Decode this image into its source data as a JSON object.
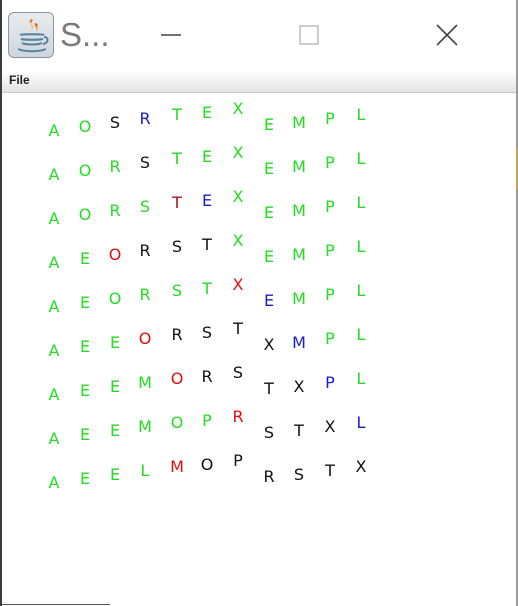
{
  "window": {
    "title": "S...",
    "icon": "java-coffee-cup-icon",
    "controls": [
      "minimize-icon",
      "maximize-icon",
      "close-icon"
    ]
  },
  "menu": {
    "file_label": "File"
  },
  "colors": {
    "green": "#22dd22",
    "black": "#111111",
    "blue": "#1a1acc",
    "red": "#dd1111",
    "darkred": "#aa1122"
  },
  "grid": {
    "rows": [
      [
        [
          "A",
          "green"
        ],
        [
          "O",
          "green"
        ],
        [
          "S",
          "black"
        ],
        [
          "R",
          "blue"
        ],
        [
          "T",
          "green"
        ],
        [
          "E",
          "green"
        ],
        [
          "X",
          "green"
        ],
        [
          "E",
          "green"
        ],
        [
          "M",
          "green"
        ],
        [
          "P",
          "green"
        ],
        [
          "L",
          "green"
        ]
      ],
      [
        [
          "A",
          "green"
        ],
        [
          "O",
          "green"
        ],
        [
          "R",
          "green"
        ],
        [
          "S",
          "black"
        ],
        [
          "T",
          "green"
        ],
        [
          "E",
          "green"
        ],
        [
          "X",
          "green"
        ],
        [
          "E",
          "green"
        ],
        [
          "M",
          "green"
        ],
        [
          "P",
          "green"
        ],
        [
          "L",
          "green"
        ]
      ],
      [
        [
          "A",
          "green"
        ],
        [
          "O",
          "green"
        ],
        [
          "R",
          "green"
        ],
        [
          "S",
          "green"
        ],
        [
          "T",
          "darkred"
        ],
        [
          "E",
          "blue"
        ],
        [
          "X",
          "green"
        ],
        [
          "E",
          "green"
        ],
        [
          "M",
          "green"
        ],
        [
          "P",
          "green"
        ],
        [
          "L",
          "green"
        ]
      ],
      [
        [
          "A",
          "green"
        ],
        [
          "E",
          "green"
        ],
        [
          "O",
          "red"
        ],
        [
          "R",
          "black"
        ],
        [
          "S",
          "black"
        ],
        [
          "T",
          "black"
        ],
        [
          "X",
          "green"
        ],
        [
          "E",
          "green"
        ],
        [
          "M",
          "green"
        ],
        [
          "P",
          "green"
        ],
        [
          "L",
          "green"
        ]
      ],
      [
        [
          "A",
          "green"
        ],
        [
          "E",
          "green"
        ],
        [
          "O",
          "green"
        ],
        [
          "R",
          "green"
        ],
        [
          "S",
          "green"
        ],
        [
          "T",
          "green"
        ],
        [
          "X",
          "red"
        ],
        [
          "E",
          "blue"
        ],
        [
          "M",
          "green"
        ],
        [
          "P",
          "green"
        ],
        [
          "L",
          "green"
        ]
      ],
      [
        [
          "A",
          "green"
        ],
        [
          "E",
          "green"
        ],
        [
          "E",
          "green"
        ],
        [
          "O",
          "red"
        ],
        [
          "R",
          "black"
        ],
        [
          "S",
          "black"
        ],
        [
          "T",
          "black"
        ],
        [
          "X",
          "black"
        ],
        [
          "M",
          "blue"
        ],
        [
          "P",
          "green"
        ],
        [
          "L",
          "green"
        ]
      ],
      [
        [
          "A",
          "green"
        ],
        [
          "E",
          "green"
        ],
        [
          "E",
          "green"
        ],
        [
          "M",
          "green"
        ],
        [
          "O",
          "red"
        ],
        [
          "R",
          "black"
        ],
        [
          "S",
          "black"
        ],
        [
          "T",
          "black"
        ],
        [
          "X",
          "black"
        ],
        [
          "P",
          "blue"
        ],
        [
          "L",
          "green"
        ]
      ],
      [
        [
          "A",
          "green"
        ],
        [
          "E",
          "green"
        ],
        [
          "E",
          "green"
        ],
        [
          "M",
          "green"
        ],
        [
          "O",
          "green"
        ],
        [
          "P",
          "green"
        ],
        [
          "R",
          "red"
        ],
        [
          "S",
          "black"
        ],
        [
          "T",
          "black"
        ],
        [
          "X",
          "black"
        ],
        [
          "L",
          "blue"
        ]
      ],
      [
        [
          "A",
          "green"
        ],
        [
          "E",
          "green"
        ],
        [
          "E",
          "green"
        ],
        [
          "L",
          "green"
        ],
        [
          "M",
          "red"
        ],
        [
          "O",
          "black"
        ],
        [
          "P",
          "black"
        ],
        [
          "R",
          "black"
        ],
        [
          "S",
          "black"
        ],
        [
          "T",
          "black"
        ],
        [
          "X",
          "black"
        ]
      ]
    ]
  }
}
